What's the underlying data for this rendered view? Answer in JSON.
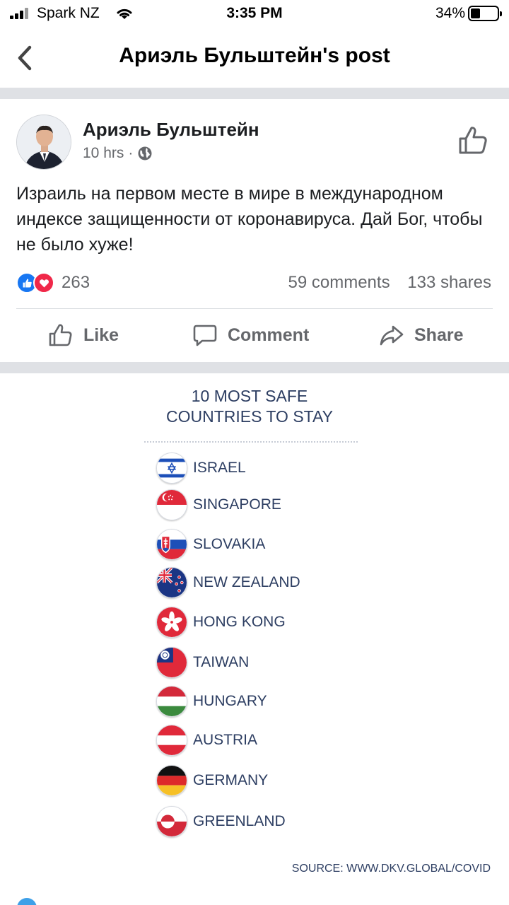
{
  "status": {
    "carrier": "Spark NZ",
    "time": "3:35 PM",
    "battery": "34%"
  },
  "header": {
    "title": "Ариэль Бульштейн's post"
  },
  "post": {
    "author": "Ариэль Бульштейн",
    "time": "10 hrs",
    "separator": "·",
    "text": "Израиль на первом месте в мире в международном индексе защищенности от коронавируса. Дай Бог, чтобы не было хуже!",
    "reaction_count": "263",
    "comments": "59 comments",
    "shares": "133 shares"
  },
  "actions": {
    "like": "Like",
    "comment": "Comment",
    "share": "Share"
  },
  "infographic": {
    "title_line1": "10 MOST SAFE",
    "title_line2": "COUNTRIES TO STAY",
    "countries": [
      "ISRAEL",
      "SINGAPORE",
      "SLOVAKIA",
      "NEW ZEALAND",
      "HONG KONG",
      "TAIWAN",
      "HUNGARY",
      "AUSTRIA",
      "GERMANY",
      "GREENLAND"
    ],
    "source": "SOURCE: WWW.DKV.GLOBAL/COVID"
  },
  "colors": {
    "facebook_blue": "#1877f2",
    "love_red": "#f02849",
    "gray_text": "#65676b",
    "infographic_text": "#2d3e62"
  }
}
